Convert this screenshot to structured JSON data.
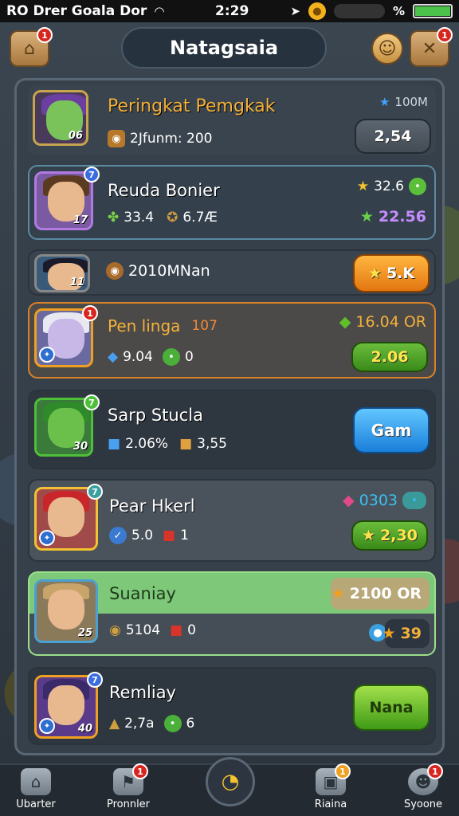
{
  "status_bar": {
    "carrier": "RO Drer Goala Dor",
    "time": "2:29",
    "battery_percent": "%"
  },
  "header": {
    "title": "Natagsaia",
    "left_badge": "1",
    "right_badge": "1"
  },
  "featured": {
    "title": "Peringkat Pemgkak",
    "subtitle": "2Jfunm: 200",
    "top_value": "100M",
    "button_label": "2,54",
    "level": "06"
  },
  "rows": [
    {
      "name": "Reuda Bonier",
      "rank": "7",
      "level": "17",
      "stat1": "33.4",
      "stat2": "6.7Æ",
      "value_top": "32.6",
      "value_bottom": "22.56"
    },
    {
      "name": "2010MNan",
      "level": "11",
      "button_label": "5.K"
    },
    {
      "name": "Pen linga",
      "sub": "107",
      "rank": "1",
      "stat1": "9.04",
      "stat2": "0",
      "value_top": "16.04 OR",
      "button_label": "2.06"
    },
    {
      "name": "Sarp Stucla",
      "rank": "7",
      "level": "30",
      "stat1": "2.06%",
      "stat2": "3,55",
      "button_label": "Gam"
    },
    {
      "name": "Pear Hkerl",
      "rank": "7",
      "stat1": "5.0",
      "stat2": "1",
      "value_top": "0303",
      "button_label": "2,30"
    },
    {
      "name": "Suaniay",
      "level": "25",
      "stat1": "5104",
      "stat2": "0",
      "value_top": "2100 OR",
      "value_bottom": "39"
    },
    {
      "name": "Remliay",
      "rank": "7",
      "level": "40",
      "stat1": "2,7a",
      "stat2": "6",
      "button_label": "Nana"
    }
  ],
  "bottom_nav": [
    {
      "label": "Ubarter"
    },
    {
      "label": "Pronnler",
      "badge": "1"
    },
    {
      "label": ""
    },
    {
      "label": "Riaina",
      "badge": "1"
    },
    {
      "label": "Syoone",
      "badge": "1"
    }
  ],
  "colors": {
    "accent_orange": "#f0a020",
    "accent_green": "#5fbf2a",
    "accent_blue": "#2a8ce0",
    "text_gold": "#f4b13a",
    "text_purple": "#c58cff"
  }
}
